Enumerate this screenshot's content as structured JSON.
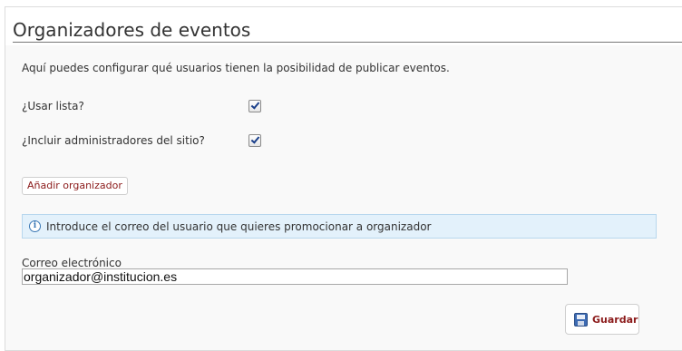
{
  "header": {
    "title": "Organizadores de eventos"
  },
  "intro_text": "Aquí puedes configurar qué usuarios tienen la posibilidad de publicar eventos.",
  "options": [
    {
      "label": "¿Usar lista?",
      "checked": true
    },
    {
      "label": "¿Incluir administradores del sitio?",
      "checked": true
    }
  ],
  "add_button_label": "Añadir organizador",
  "info": {
    "icon": "info-icon",
    "text": "Introduce el correo del usuario que quieres promocionar a organizador"
  },
  "email_field": {
    "label": "Correo electrónico",
    "value": "organizador@institucion.es"
  },
  "save_button": {
    "icon": "floppy-disk-icon",
    "label": "Guardar"
  },
  "colors": {
    "accent_text": "#8b1a1a",
    "info_background": "#e3f1fb",
    "info_border": "#b8d7ee"
  }
}
